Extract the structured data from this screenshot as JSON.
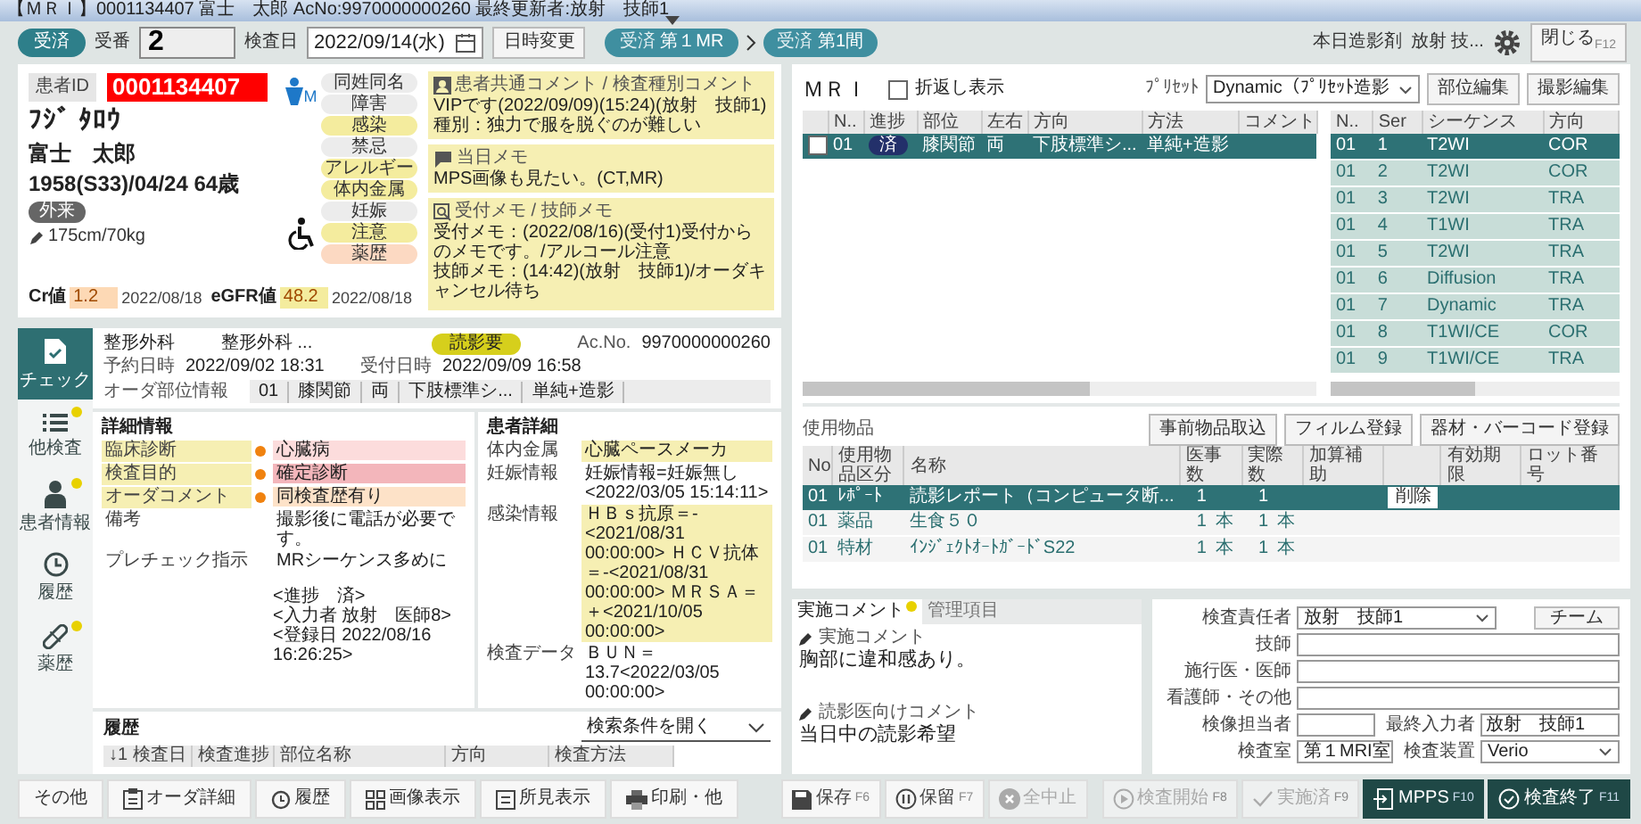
{
  "window": {
    "title": "【ＭＲＩ】0001134407 富士　太郎 AcNo:9970000000260 最終更新者:放射　技師1"
  },
  "toolbar": {
    "status": "受済",
    "reception_label": "受番",
    "reception_no": "2",
    "exam_date_label": "検査日",
    "exam_date": "2022/09/14(水)",
    "change_button": "日時変更",
    "flow": [
      {
        "tag": "受済",
        "label": "第１MR",
        "current": true
      },
      {
        "tag": "受済",
        "label": "第1間",
        "current": false
      }
    ],
    "contrast": "本日造影剤",
    "user": "放射 技...",
    "close_button": "閉じる",
    "close_key": "F12"
  },
  "patient": {
    "id_label": "患者ID",
    "id": "0001134407",
    "kana": "ﾌｼﾞ ﾀﾛｳ",
    "name": "富士　太郎",
    "birth": "1958(S33)/04/24 64歳",
    "visit": "外来",
    "body": "175cm/70kg",
    "gender": "M",
    "labs": [
      {
        "label": "Cr値",
        "value": "1.2",
        "date": "2022/08/18",
        "color": "#fdd9b5"
      },
      {
        "label": "eGFR値",
        "value": "48.2",
        "date": "2022/08/18",
        "color": "#f4ec9e"
      }
    ],
    "flags": [
      {
        "label": "同姓同名",
        "color": "#ececec"
      },
      {
        "label": "障害",
        "color": "#ececec"
      },
      {
        "label": "感染",
        "color": "#f4ec9e"
      },
      {
        "label": "禁忌",
        "color": "#ececec"
      },
      {
        "label": "アレルギー",
        "color": "#f4ec9e"
      },
      {
        "label": "体内金属",
        "color": "#f4ec9e"
      },
      {
        "label": "妊娠",
        "color": "#ececec"
      },
      {
        "label": "注意",
        "color": "#f4ec9e"
      },
      {
        "label": "薬歴",
        "color": "#fcd9c2"
      }
    ]
  },
  "comments": {
    "common": {
      "title": "患者共通コメント / 検査種別コメント",
      "lines": [
        "VIPです(2022/09/09)(15:24)(放射　技師1)",
        "種別：独力で服を脱ぐのが難しい"
      ]
    },
    "today": {
      "title": "当日メモ",
      "lines": [
        "MPS画像も見たい。(CT,MR)"
      ]
    },
    "memo": {
      "title": "受付メモ / 技師メモ",
      "lines": [
        "受付メモ：(2022/08/16)(受付1)受付からのメモです。/アルコール注意",
        "技師メモ：(14:42)(放射　技師1)/オーダキャンセル待ち"
      ]
    }
  },
  "nav": [
    {
      "label": "チェック",
      "kind": "check",
      "selected": true,
      "dot": false
    },
    {
      "label": "他検査",
      "kind": "list",
      "selected": false,
      "dot": true
    },
    {
      "label": "患者情報",
      "kind": "person",
      "selected": false,
      "dot": true
    },
    {
      "label": "履歴",
      "kind": "history",
      "selected": false,
      "dot": false
    },
    {
      "label": "薬歴",
      "kind": "pill",
      "selected": false,
      "dot": true
    }
  ],
  "order": {
    "department": "整形外科",
    "doctor": "整形外科 ...",
    "badge": "読影要",
    "acno_label": "Ac.No.",
    "acno": "9970000000260",
    "reserved_label": "予約日時",
    "reserved": "2022/09/02 18:31",
    "accepted_label": "受付日時",
    "accepted": "2022/09/09 16:58",
    "parts_label": "オーダ部位情報",
    "parts": [
      "01",
      "膝関節",
      "両",
      "下肢標準シ...",
      "単純+造影"
    ]
  },
  "details": {
    "title": "詳細情報",
    "rows": [
      {
        "label": "臨床診断",
        "value": "心臓病",
        "alert": true,
        "color": "#fcdcdc"
      },
      {
        "label": "検査目的",
        "value": "確定診断",
        "alert": true,
        "color": "#f3b6bb"
      },
      {
        "label": "オーダコメント",
        "value": "同検査歴有り",
        "alert": true,
        "color": "#fde2c8"
      },
      {
        "label": "備考",
        "value": "撮影後に電話が必要です。",
        "alert": false
      },
      {
        "label": "プレチェック指示",
        "value": "MRシーケンス多めに",
        "notes": [
          "<進捗　済>",
          "<入力者 放射　医師8>",
          "<登録日 2022/08/16 16:26:25>"
        ],
        "alert": false
      }
    ]
  },
  "patient_details": {
    "title": "患者詳細",
    "rows": [
      {
        "label": "体内金属",
        "value": "心臓ペースメーカ",
        "highlight": true
      },
      {
        "label": "妊娠情報",
        "value": "妊娠情報=妊娠無し<2022/03/05 15:14:11>",
        "highlight": false
      },
      {
        "label": "感染情報",
        "value": "ＨＢｓ抗原＝-<2021/08/31 00:00:00> ＨＣＶ抗体＝-<2021/08/31 00:00:00> ＭＲＳＡ＝＋<2021/10/05 00:00:00>",
        "highlight": true
      },
      {
        "label": "検査データ",
        "value": "ＢＵＮ＝13.7<2022/03/05 00:00:00>",
        "highlight": false
      }
    ]
  },
  "history": {
    "title": "履歴",
    "search": "検索条件を開く",
    "columns": [
      "↓1 検査日",
      "検査進捗",
      "部位名称",
      "方向",
      "検査方法"
    ]
  },
  "mri": {
    "title": "ＭＲＩ",
    "wrap": {
      "label": "折返し表示",
      "checked": false
    },
    "preset_label": "ﾌﾟﾘｾｯﾄ",
    "preset": "Dynamic（ﾌﾟﾘｾｯﾄ造影",
    "buttons": [
      "部位編集",
      "撮影編集"
    ],
    "part_columns": [
      "N..",
      "進捗",
      "部位",
      "左右",
      "方向",
      "方法",
      "コメント"
    ],
    "parts": [
      {
        "checked": false,
        "no": "01",
        "status": "済",
        "part": "膝関節",
        "side": "両",
        "direction": "下肢標準シ...",
        "method": "単純+造影",
        "selected": true
      }
    ],
    "series_columns": [
      "N..",
      "Ser",
      "シーケンス",
      "方向"
    ],
    "series": [
      {
        "no": "01",
        "ser": "1",
        "sequence": "T2WI",
        "direction": "COR",
        "selected": true
      },
      {
        "no": "01",
        "ser": "2",
        "sequence": "T2WI",
        "direction": "COR",
        "selected": false
      },
      {
        "no": "01",
        "ser": "3",
        "sequence": "T2WI",
        "direction": "TRA",
        "selected": false
      },
      {
        "no": "01",
        "ser": "4",
        "sequence": "T1WI",
        "direction": "TRA",
        "selected": false
      },
      {
        "no": "01",
        "ser": "5",
        "sequence": "T2WI",
        "direction": "TRA",
        "selected": false
      },
      {
        "no": "01",
        "ser": "6",
        "sequence": "Diffusion",
        "direction": "TRA",
        "selected": false
      },
      {
        "no": "01",
        "ser": "7",
        "sequence": "Dynamic",
        "direction": "TRA",
        "selected": false
      },
      {
        "no": "01",
        "ser": "8",
        "sequence": "T1WI/CE",
        "direction": "COR",
        "selected": false
      },
      {
        "no": "01",
        "ser": "9",
        "sequence": "T1WI/CE",
        "direction": "TRA",
        "selected": false
      }
    ]
  },
  "goods": {
    "title": "使用物品",
    "buttons": [
      "事前物品取込",
      "フィルム登録",
      "器材・バーコード登録"
    ],
    "columns": [
      "No",
      "使用物品区分",
      "名称",
      "医事数",
      "実際数",
      "加算補助",
      "有効期限",
      "ロット番号"
    ],
    "rows": [
      {
        "no": "01",
        "category": "ﾚﾎﾟｰﾄ",
        "name": "読影レポート（コンピュータ断...",
        "med_qty": "1",
        "actual_qty": "1",
        "selected": true,
        "delete_button": "削除"
      },
      {
        "no": "01",
        "category": "薬品",
        "name": "生食５０",
        "med_qty": "1",
        "med_unit": "本",
        "actual_qty": "1",
        "actual_unit": "本",
        "selected": false
      },
      {
        "no": "01",
        "category": "特材",
        "name": "ｲﾝｼﾞｪｸﾄｵｰﾄｶﾞｰﾄﾞS22",
        "med_qty": "1",
        "med_unit": "本",
        "actual_qty": "1",
        "actual_unit": "本",
        "selected": false
      }
    ]
  },
  "exam_comments": {
    "tabs": [
      {
        "label": "実施コメント",
        "selected": true,
        "dot": true
      },
      {
        "label": "管理項目",
        "selected": false,
        "dot": false
      }
    ],
    "sections": [
      {
        "title": "実施コメント",
        "text": "胸部に違和感あり。"
      },
      {
        "title": "読影医向けコメント",
        "text": "当日中の読影希望"
      }
    ]
  },
  "staff": {
    "team_button": "チーム",
    "fields": [
      {
        "label": "検査責任者",
        "value": "放射　技師1",
        "kind": "select"
      },
      {
        "label": "技師",
        "kind": "text"
      },
      {
        "label": "施行医・医師",
        "kind": "text"
      },
      {
        "label": "看護師・その他",
        "kind": "text"
      }
    ],
    "pairs": [
      [
        {
          "label": "検像担当者",
          "kind": "text"
        },
        {
          "label": "最終入力者",
          "value": "放射　技師1",
          "kind": "text"
        }
      ],
      [
        {
          "label": "検査室",
          "value": "第１MRI室",
          "kind": "select"
        },
        {
          "label": "検査装置",
          "value": "Verio",
          "kind": "select"
        }
      ]
    ]
  },
  "left_buttons": [
    {
      "label": "その他",
      "kind": "plain"
    },
    {
      "label": "オーダ詳細",
      "kind": "order"
    },
    {
      "label": "履歴",
      "kind": "history"
    },
    {
      "label": "画像表示",
      "kind": "image"
    },
    {
      "label": "所見表示",
      "kind": "report"
    },
    {
      "label": "印刷・他",
      "kind": "print"
    }
  ],
  "right_buttons": [
    {
      "label": "保存",
      "key": "F6",
      "kind": "save",
      "primary": false,
      "disabled": false
    },
    {
      "label": "保留",
      "key": "F7",
      "kind": "hold",
      "primary": false,
      "disabled": false
    },
    {
      "label": "全中止",
      "kind": "abort",
      "primary": false,
      "disabled": true
    },
    {
      "label": "検査開始",
      "key": "F8",
      "kind": "start",
      "primary": false,
      "disabled": true
    },
    {
      "label": "実施済",
      "key": "F9",
      "kind": "done",
      "primary": false,
      "disabled": true
    },
    {
      "label": "MPPS",
      "key": "F10",
      "kind": "mpps",
      "primary": true,
      "disabled": false
    },
    {
      "label": "検査終了",
      "key": "F11",
      "kind": "finish",
      "primary": true,
      "disabled": false
    }
  ]
}
